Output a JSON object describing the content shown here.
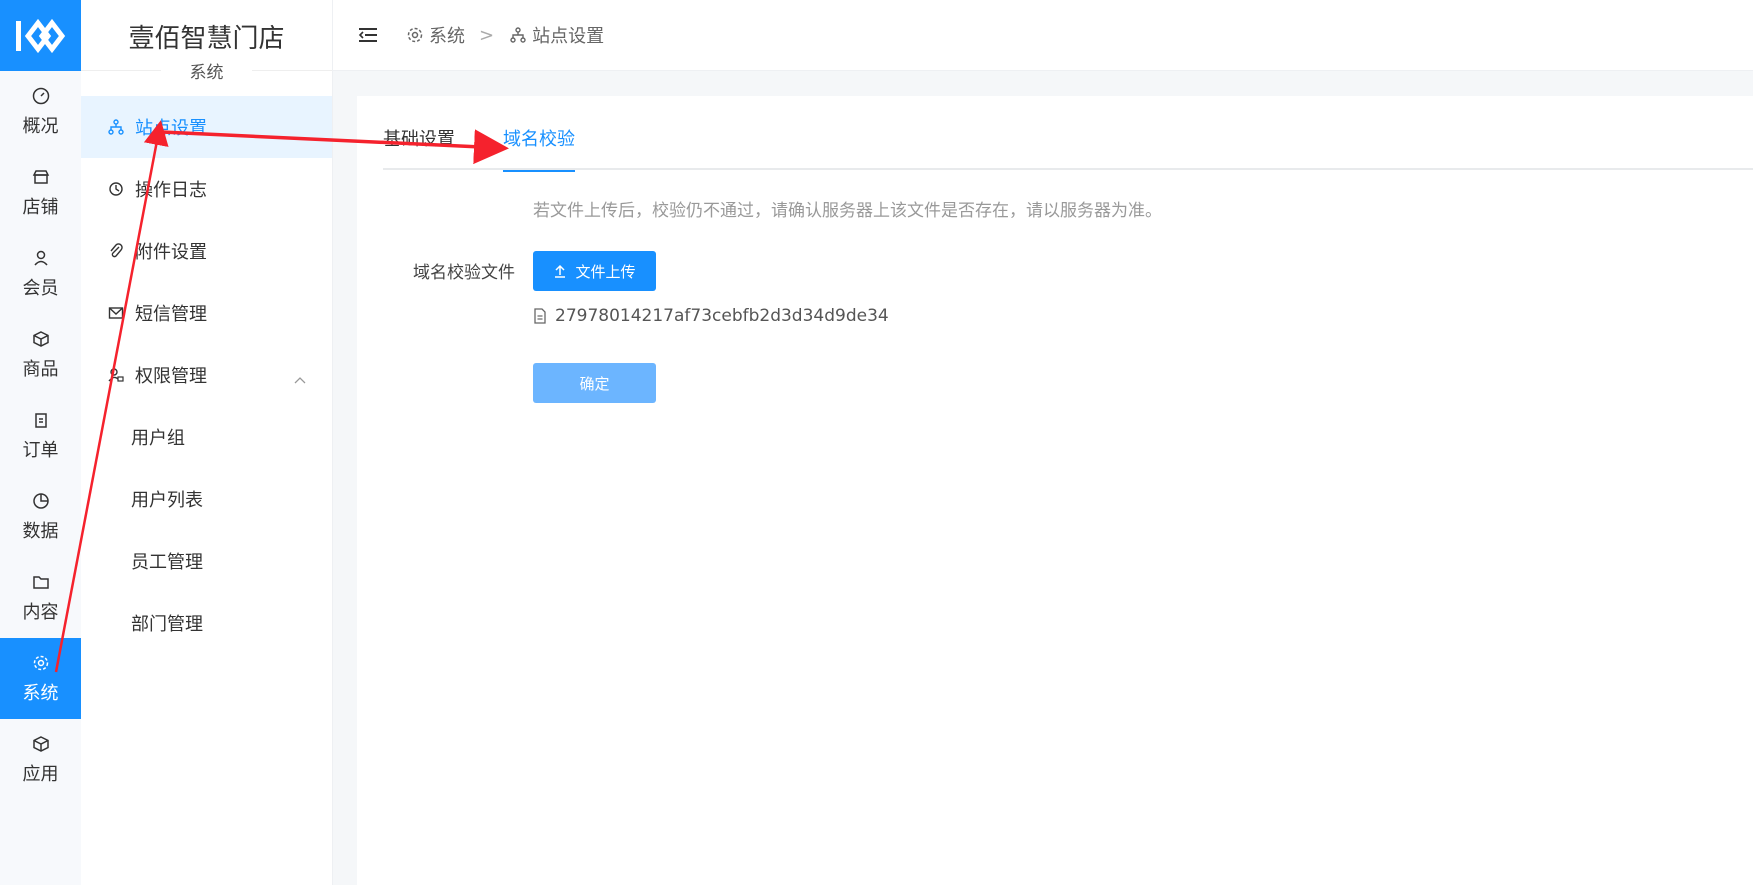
{
  "rail": {
    "items": [
      {
        "label": "概况",
        "icon": "dashboard-icon"
      },
      {
        "label": "店铺",
        "icon": "shop-icon"
      },
      {
        "label": "会员",
        "icon": "user-icon"
      },
      {
        "label": "商品",
        "icon": "box-icon"
      },
      {
        "label": "订单",
        "icon": "clipboard-icon"
      },
      {
        "label": "数据",
        "icon": "pie-chart-icon"
      },
      {
        "label": "内容",
        "icon": "folder-icon"
      },
      {
        "label": "系统",
        "icon": "gear-icon"
      },
      {
        "label": "应用",
        "icon": "cube-icon"
      }
    ],
    "active": "系统"
  },
  "sidebar": {
    "brand": "壹佰智慧门店",
    "section": "系统",
    "items": [
      {
        "label": "站点设置",
        "icon": "sitemap-icon"
      },
      {
        "label": "操作日志",
        "icon": "history-icon"
      },
      {
        "label": "附件设置",
        "icon": "paperclip-icon"
      },
      {
        "label": "短信管理",
        "icon": "mail-icon"
      },
      {
        "label": "权限管理",
        "icon": "user-lock-icon"
      }
    ],
    "subitems": [
      "用户组",
      "用户列表",
      "员工管理",
      "部门管理"
    ]
  },
  "header": {
    "crumbs": [
      "系统",
      "站点设置"
    ],
    "separator": ">"
  },
  "main": {
    "tabs": [
      "基础设置",
      "域名校验"
    ],
    "active_tab": "域名校验",
    "notice": "若文件上传后，校验仍不通过，请确认服务器上该文件是否存在，请以服务器为准。",
    "field_label": "域名校验文件",
    "upload_label": "文件上传",
    "file_name": "27978014217af73cebfb2d3d34d9de34",
    "confirm_label": "确定"
  },
  "colors": {
    "accent": "#1890ff",
    "accent_light": "#6cb5ff",
    "annotation": "#f5222d"
  }
}
